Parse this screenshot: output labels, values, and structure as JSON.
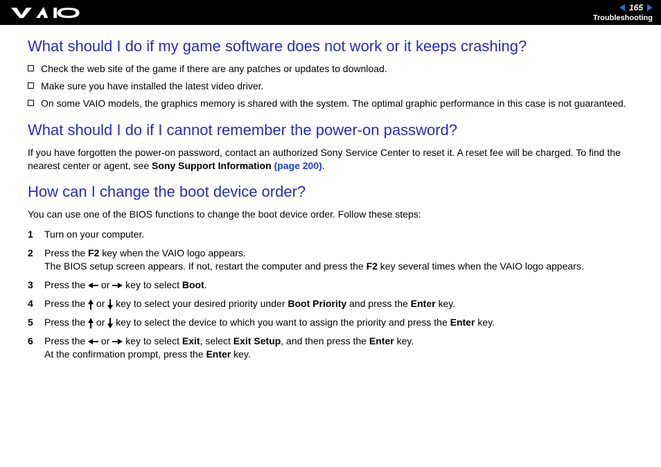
{
  "header": {
    "page_number": "165",
    "section": "Troubleshooting",
    "logo_alt": "VAIO"
  },
  "q1": {
    "heading": "What should I do if my game software does not work or it keeps crashing?",
    "bullets": [
      "Check the web site of the game if there are any patches or updates to download.",
      "Make sure you have installed the latest video driver.",
      "On some VAIO models, the graphics memory is shared with the system. The optimal graphic performance in this case is not guaranteed."
    ]
  },
  "q2": {
    "heading": "What should I do if I cannot remember the power-on password?",
    "para_a": "If you have forgotten the power-on password, contact an authorized Sony Service Center to reset it. A reset fee will be charged. To find the nearest center or agent, see ",
    "link_label": "Sony Support Information ",
    "link_page": "(page 200)",
    "para_b": "."
  },
  "q3": {
    "heading": "How can I change the boot device order?",
    "intro": "You can use one of the BIOS functions to change the boot device order. Follow these steps:",
    "steps": {
      "s1": "Turn on your computer.",
      "s2_a": "Press the ",
      "s2_key": "F2",
      "s2_b": " key when the VAIO logo appears.",
      "s2_c": "The BIOS setup screen appears. If not, restart the computer and press the ",
      "s2_d": " key several times when the VAIO logo appears.",
      "s3_a": "Press the ",
      "s3_b": " or ",
      "s3_c": " key to select ",
      "s3_boot": "Boot",
      "s3_d": ".",
      "s4_a": "Press the ",
      "s4_b": " or ",
      "s4_c": " key to select your desired priority under ",
      "s4_bp": "Boot Priority",
      "s4_d": " and press the ",
      "s4_enter": "Enter",
      "s4_e": " key.",
      "s5_a": "Press the ",
      "s5_b": " or ",
      "s5_c": " key to select the device to which you want to assign the priority and press the ",
      "s5_enter": "Enter",
      "s5_d": " key.",
      "s6_a": "Press the ",
      "s6_b": " or ",
      "s6_c": " key to select ",
      "s6_exit": "Exit",
      "s6_d": ", select ",
      "s6_exitsetup": "Exit Setup",
      "s6_e": ", and then press the ",
      "s6_enter": "Enter",
      "s6_f": " key.",
      "s6_g": "At the confirmation prompt, press the ",
      "s6_h": " key."
    },
    "nums": {
      "n1": "1",
      "n2": "2",
      "n3": "3",
      "n4": "4",
      "n5": "5",
      "n6": "6"
    }
  }
}
